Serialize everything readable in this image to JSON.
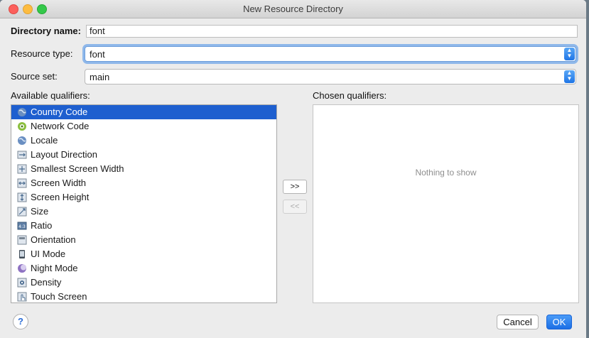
{
  "window": {
    "title": "New Resource Directory"
  },
  "form": {
    "directory_name_label": "Directory name:",
    "directory_name_value": "font",
    "resource_type_label": "Resource type:",
    "resource_type_value": "font",
    "source_set_label": "Source set:",
    "source_set_value": "main"
  },
  "available": {
    "label": "Available qualifiers:",
    "items": [
      {
        "label": "Country Code",
        "icon": "globe-icon"
      },
      {
        "label": "Network Code",
        "icon": "network-icon"
      },
      {
        "label": "Locale",
        "icon": "globe-icon"
      },
      {
        "label": "Layout Direction",
        "icon": "layout-direction-icon"
      },
      {
        "label": "Smallest Screen Width",
        "icon": "smallest-width-icon"
      },
      {
        "label": "Screen Width",
        "icon": "screen-width-icon"
      },
      {
        "label": "Screen Height",
        "icon": "screen-height-icon"
      },
      {
        "label": "Size",
        "icon": "size-icon"
      },
      {
        "label": "Ratio",
        "icon": "ratio-icon"
      },
      {
        "label": "Orientation",
        "icon": "orientation-icon"
      },
      {
        "label": "UI Mode",
        "icon": "phone-icon"
      },
      {
        "label": "Night Mode",
        "icon": "night-mode-icon"
      },
      {
        "label": "Density",
        "icon": "density-icon"
      },
      {
        "label": "Touch Screen",
        "icon": "touch-icon"
      }
    ],
    "selected_index": 0
  },
  "chosen": {
    "label": "Chosen qualifiers:",
    "empty_text": "Nothing to show"
  },
  "transfer": {
    "add_label": ">>",
    "remove_label": "<<"
  },
  "buttons": {
    "help_label": "?",
    "cancel_label": "Cancel",
    "ok_label": "OK"
  },
  "colors": {
    "selection": "#1e5fcf",
    "accent": "#1b6fe5",
    "focus_ring": "#8fb8ea"
  }
}
